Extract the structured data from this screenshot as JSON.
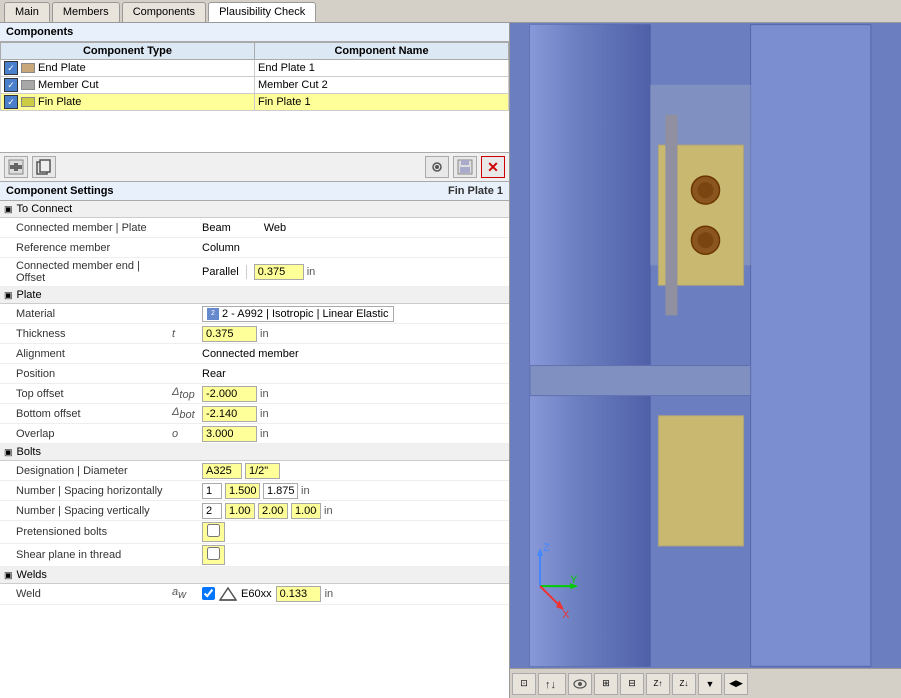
{
  "tabs": [
    {
      "label": "Main",
      "active": false
    },
    {
      "label": "Members",
      "active": false
    },
    {
      "label": "Components",
      "active": true
    },
    {
      "label": "Plausibility Check",
      "active": false
    }
  ],
  "components_section": {
    "title": "Components",
    "columns": [
      "Component Type",
      "Component Name"
    ],
    "rows": [
      {
        "checked": true,
        "type": "End Plate",
        "name": "End Plate 1",
        "selected": false,
        "color": "tan"
      },
      {
        "checked": true,
        "type": "Member Cut",
        "name": "Member Cut 2",
        "selected": false,
        "color": "gray"
      },
      {
        "checked": true,
        "type": "Fin Plate",
        "name": "Fin Plate 1",
        "selected": true,
        "color": "yellow"
      }
    ]
  },
  "toolbar_buttons": [
    {
      "label": "⬜",
      "name": "btn1"
    },
    {
      "label": "⬜",
      "name": "btn2"
    },
    {
      "label": "↩",
      "name": "btn3"
    },
    {
      "label": "💾",
      "name": "btn4"
    },
    {
      "label": "✕",
      "name": "btn5",
      "red": true
    }
  ],
  "settings": {
    "title": "Component Settings",
    "subtitle": "Fin Plate 1",
    "sections": [
      {
        "name": "To Connect",
        "rows": [
          {
            "label": "Connected member | Plate",
            "mid": "",
            "values": [
              "Beam",
              "Web"
            ]
          },
          {
            "label": "Reference member",
            "mid": "",
            "values": [
              "Column"
            ]
          },
          {
            "label": "Connected member end | Offset",
            "mid": "",
            "values": [
              "Parallel",
              "0.375",
              "in"
            ]
          }
        ]
      },
      {
        "name": "Plate",
        "rows": [
          {
            "label": "Material",
            "mid": "",
            "values": [
              "material",
              "2 - A992 | Isotropic | Linear Elastic"
            ]
          },
          {
            "label": "Thickness",
            "mid": "t",
            "values": [
              "0.375",
              "in"
            ]
          },
          {
            "label": "Alignment",
            "mid": "",
            "values": [
              "Connected member"
            ]
          },
          {
            "label": "Position",
            "mid": "",
            "values": [
              "Rear"
            ]
          },
          {
            "label": "Top offset",
            "mid": "Δtop",
            "values": [
              "-2.000",
              "in"
            ]
          },
          {
            "label": "Bottom offset",
            "mid": "Δbot",
            "values": [
              "-2.140",
              "in"
            ]
          },
          {
            "label": "Overlap",
            "mid": "o",
            "values": [
              "3.000",
              "in"
            ]
          }
        ]
      },
      {
        "name": "Bolts",
        "rows": [
          {
            "label": "Designation | Diameter",
            "mid": "",
            "values": [
              "A325",
              "1/2\""
            ]
          },
          {
            "label": "Number | Spacing horizontally",
            "mid": "",
            "values": [
              "1",
              "1.500",
              "1.875",
              "in"
            ]
          },
          {
            "label": "Number | Spacing vertically",
            "mid": "",
            "values": [
              "2",
              "1.000",
              "2.000",
              "1.000",
              "in"
            ]
          },
          {
            "label": "Pretensioned bolts",
            "mid": "",
            "values": [
              "checkbox"
            ]
          },
          {
            "label": "Shear plane in thread",
            "mid": "",
            "values": [
              "checkbox2"
            ]
          }
        ]
      },
      {
        "name": "Welds",
        "rows": [
          {
            "label": "Weld",
            "mid": "aw",
            "values": [
              "checkbox_checked",
              "weld_icon",
              "E60xx",
              "0.133",
              "in"
            ]
          }
        ]
      }
    ]
  },
  "bottom_toolbar_buttons": [
    "⊡",
    "↑↓",
    "👁",
    "⊞",
    "⊟",
    "Z↑",
    "Z↓",
    "▼",
    "◀▶"
  ],
  "colors": {
    "bg_left": "#ffffff",
    "bg_right": "#6b7fc0",
    "section_header": "#e8f0fb",
    "selected_row": "#ffff99",
    "input_yellow": "#ffff99"
  }
}
